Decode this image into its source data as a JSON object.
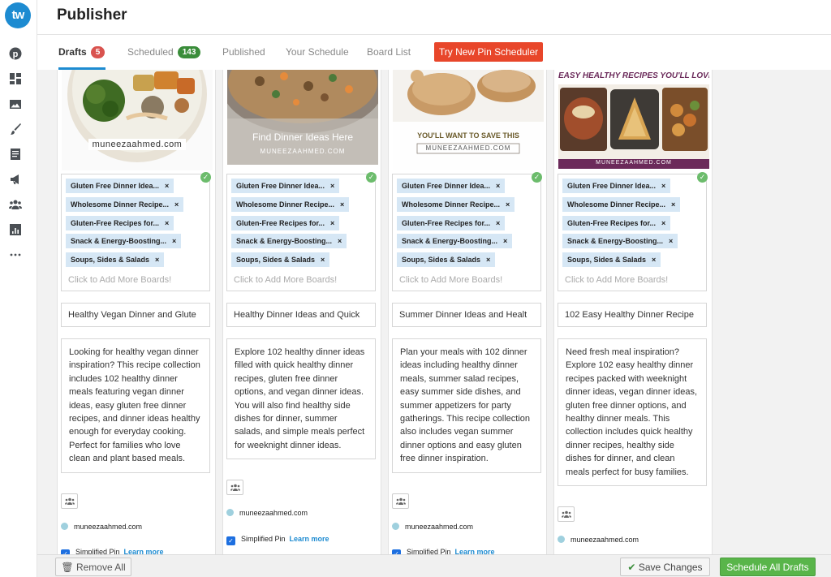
{
  "app": {
    "logo_text": "tw",
    "title": "Publisher"
  },
  "sidebar": {
    "icons": [
      "pinterest-icon",
      "dashboard-icon",
      "image-icon",
      "brush-icon",
      "document-icon",
      "megaphone-icon",
      "people-icon",
      "analytics-icon",
      "more-icon"
    ]
  },
  "tabs": {
    "drafts": {
      "label": "Drafts",
      "count": "5"
    },
    "scheduled": {
      "label": "Scheduled",
      "count": "143"
    },
    "published": {
      "label": "Published"
    },
    "your_schedule": {
      "label": "Your Schedule"
    },
    "board_list": {
      "label": "Board List"
    },
    "try_button": "Try New Pin Scheduler"
  },
  "colors": {
    "accent": "#1d8bd1",
    "try_button": "#e8462a",
    "badge_red": "#d9534f",
    "badge_green": "#3a8d3a",
    "schedule_button": "#59b54a",
    "board_chip": "#d6e7f5"
  },
  "common": {
    "boards": [
      "Gluten Free Dinner Idea...",
      "Wholesome Dinner Recipe...",
      "Gluten-Free Recipes for...",
      "Snack & Energy-Boosting...",
      "Soups, Sides & Salads"
    ],
    "add_more": "Click to Add More Boards!",
    "simplified_pin": "Simplified Pin",
    "learn_more": "Learn more"
  },
  "pins": [
    {
      "image_caption": "muneezaahmed.com",
      "title": "Healthy Vegan Dinner and Glute",
      "description": "Looking for healthy vegan dinner inspiration? This recipe collection includes 102 healthy dinner meals featuring vegan dinner ideas, easy gluten free dinner recipes, and dinner ideas healthy enough for everyday cooking. Perfect for families who love clean and plant based meals.",
      "site": "muneezaahmed.com"
    },
    {
      "image_caption": "Find Dinner Ideas Here",
      "image_caption2": "MUNEEZAAHMED.COM",
      "title": "Healthy Dinner Ideas and Quick",
      "description": "Explore 102 healthy dinner ideas filled with quick healthy dinner recipes, gluten free dinner options, and vegan dinner ideas. You will also find healthy side dishes for dinner, summer salads, and simple meals perfect for weeknight dinner ideas.",
      "site": "muneezaahmed.com"
    },
    {
      "image_caption": "YOU'LL WANT TO SAVE THIS",
      "image_caption2": "MUNEEZAAHMED.COM",
      "title": "Summer Dinner Ideas and Healt",
      "description": "Plan your meals with 102 dinner ideas including healthy dinner meals, summer salad recipes, easy summer side dishes, and summer appetizers for party gatherings. This recipe collection also includes vegan summer dinner options and easy gluten free dinner inspiration.",
      "site": "muneezaahmed.com"
    },
    {
      "image_caption": "EASY HEALTHY RECIPES YOU'LL LOVE",
      "image_caption2": "MUNEEZAAHMED.COM",
      "title": "102 Easy Healthy Dinner Recipe",
      "description": "Need fresh meal inspiration? Explore 102 easy healthy dinner recipes packed with weeknight dinner ideas, vegan dinner ideas, gluten free dinner options, and healthy dinner meals. This collection includes quick healthy dinner recipes, healthy side dishes for dinner, and clean meals perfect for busy families.",
      "site": "muneezaahmed.com"
    }
  ],
  "footer": {
    "remove_all": "Remove All",
    "save_changes": "Save Changes",
    "schedule_all": "Schedule All Drafts"
  }
}
